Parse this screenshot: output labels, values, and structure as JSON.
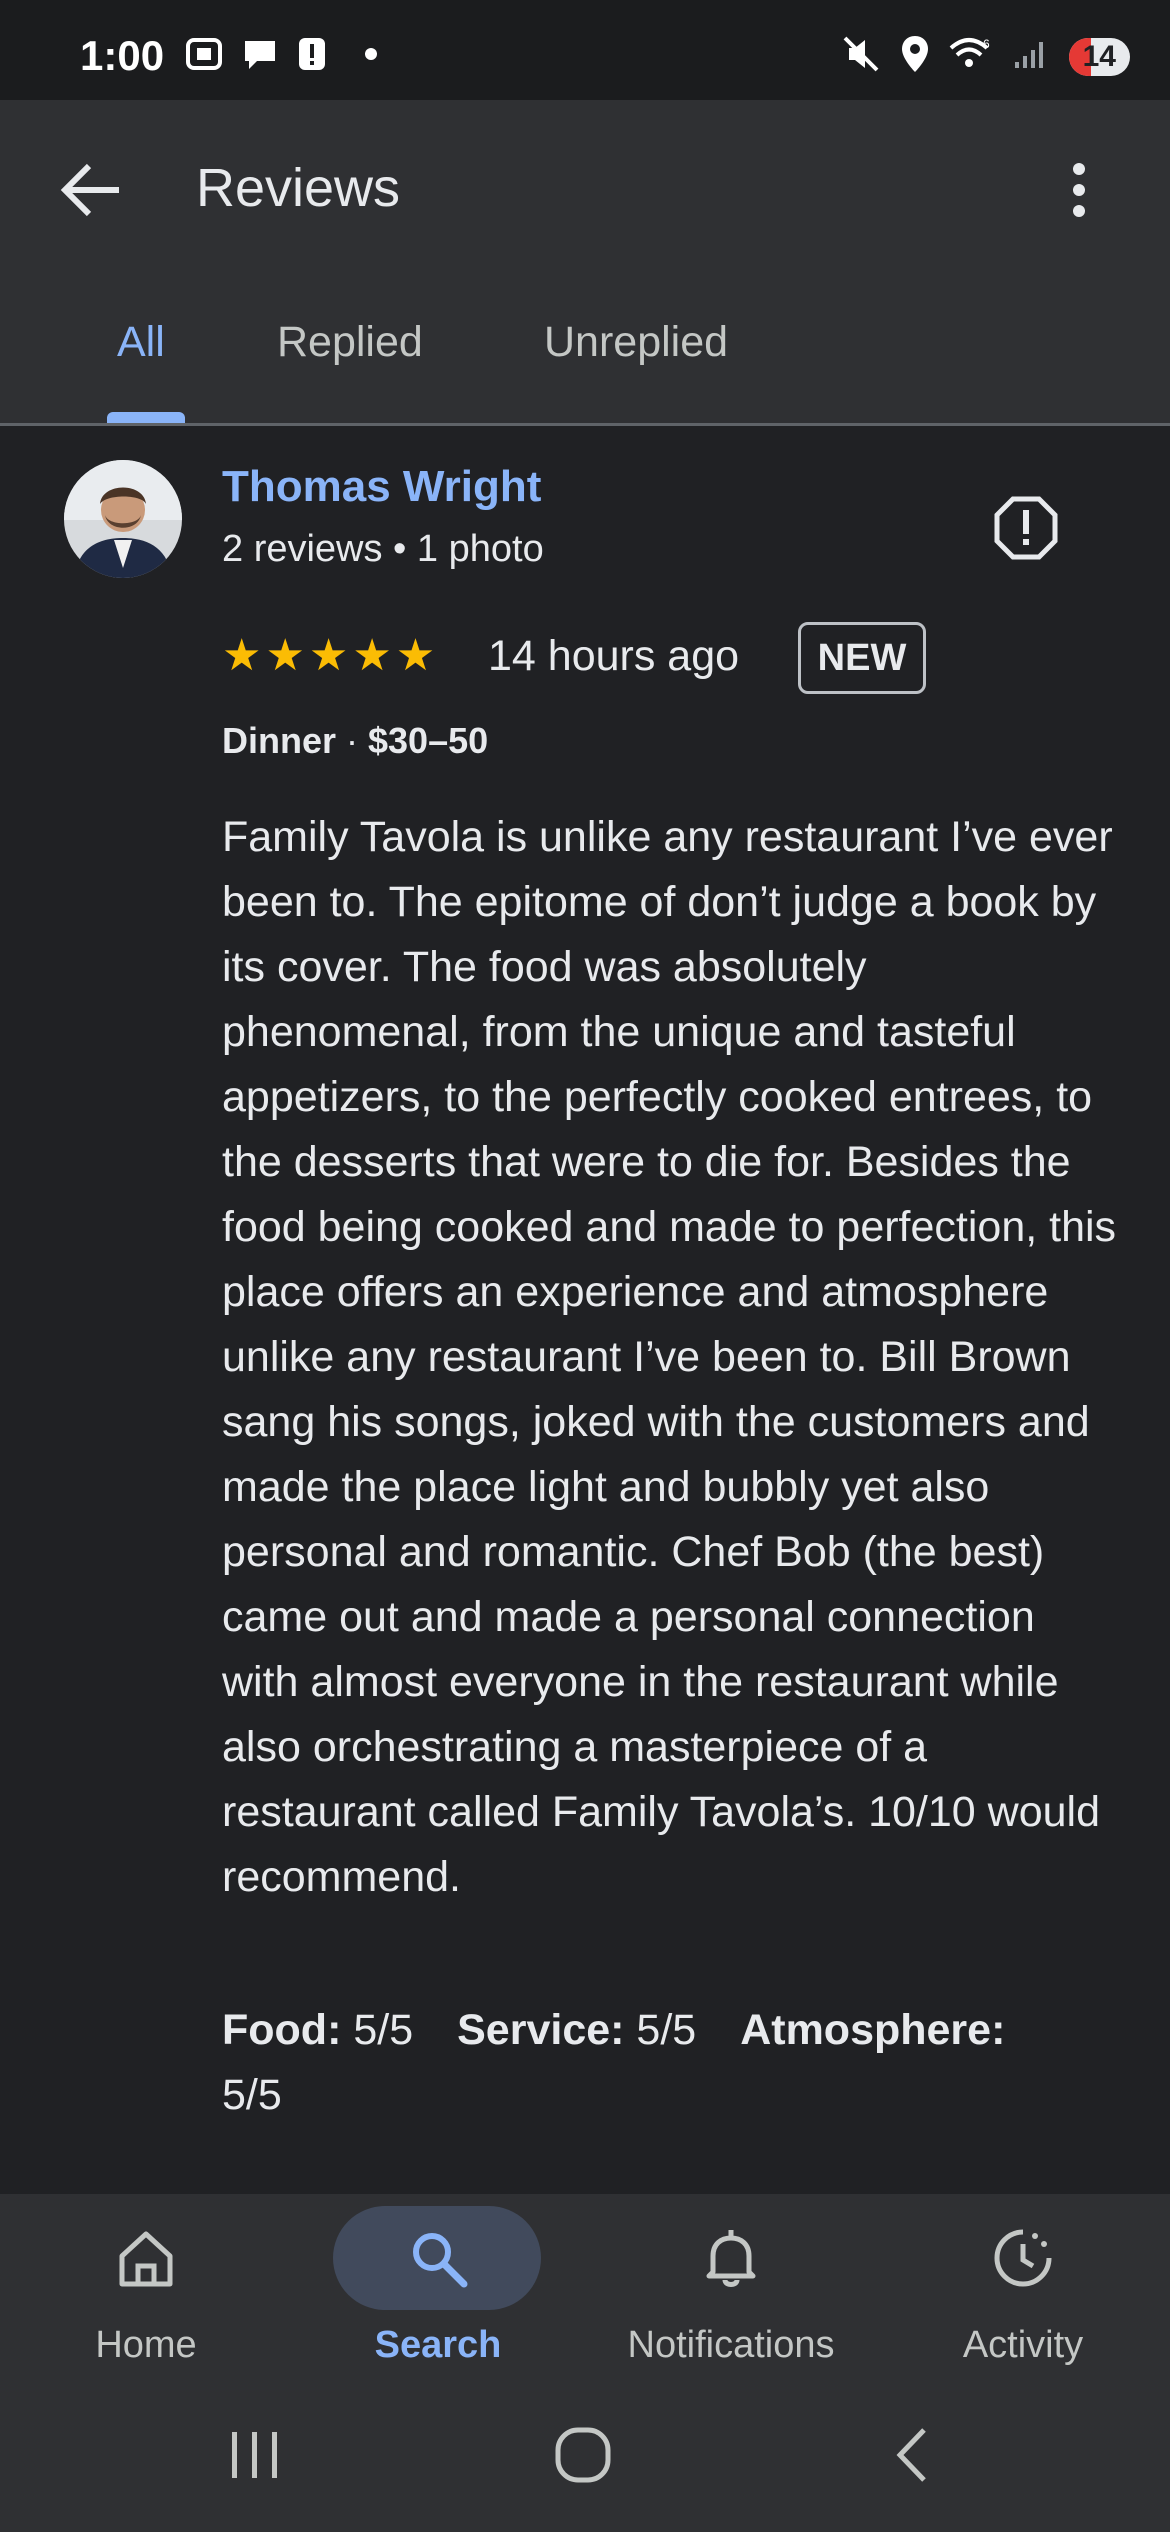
{
  "status_bar": {
    "time": "1:00",
    "battery": "14",
    "icons_left": [
      "screenshot-icon",
      "chat-bubble-icon",
      "alert-icon",
      "dot-icon"
    ],
    "icons_right": [
      "mute-icon",
      "location-icon",
      "wifi-icon",
      "signal-icon"
    ]
  },
  "app_bar": {
    "title": "Reviews",
    "back_icon": "arrow-back-icon",
    "more_icon": "more-vertical-icon"
  },
  "tabs": [
    {
      "label": "All",
      "active": true
    },
    {
      "label": "Replied",
      "active": false
    },
    {
      "label": "Unreplied",
      "active": false
    }
  ],
  "review": {
    "reviewer_name": "Thomas Wright",
    "reviewer_meta": "2 reviews • 1 photo",
    "stars": "★★★★★",
    "rating": 5,
    "time_ago": "14 hours ago",
    "badge": "NEW",
    "meal_type": "Dinner",
    "price_range": "$30–50",
    "text": "Family Tavola is unlike any restaurant I’ve ever been to. The epitome of don’t judge a book by its cover. The food was absolutely phenomenal, from the unique and tasteful appetizers, to the perfectly cooked entrees, to the desserts that were to die for. Besides the food being cooked and made to perfection, this place offers an experience and atmosphere unlike any restaurant I’ve been to. Bill Brown sang his songs, joked with the customers and made the place light and bubbly yet also personal and romantic. Chef Bob (the best) came out and made a personal connection with almost everyone in the restaurant while also orchestrating a masterpiece of a restaurant called Family Tavola’s. 10/10 would recommend.",
    "ratings": {
      "food_label": "Food:",
      "food_value": "5/5",
      "service_label": "Service:",
      "service_value": "5/5",
      "atmosphere_label": "Atmosphere:",
      "atmosphere_value": "5/5"
    }
  },
  "bottom_nav": [
    {
      "label": "Home",
      "icon": "home-icon",
      "active": false
    },
    {
      "label": "Search",
      "icon": "search-icon",
      "active": true
    },
    {
      "label": "Notifications",
      "icon": "bell-icon",
      "active": false
    },
    {
      "label": "Activity",
      "icon": "activity-icon",
      "active": false
    }
  ],
  "colors": {
    "accent": "#8ab4f8",
    "star": "#fbbc04",
    "background": "#202124",
    "surface": "#2f3033"
  }
}
